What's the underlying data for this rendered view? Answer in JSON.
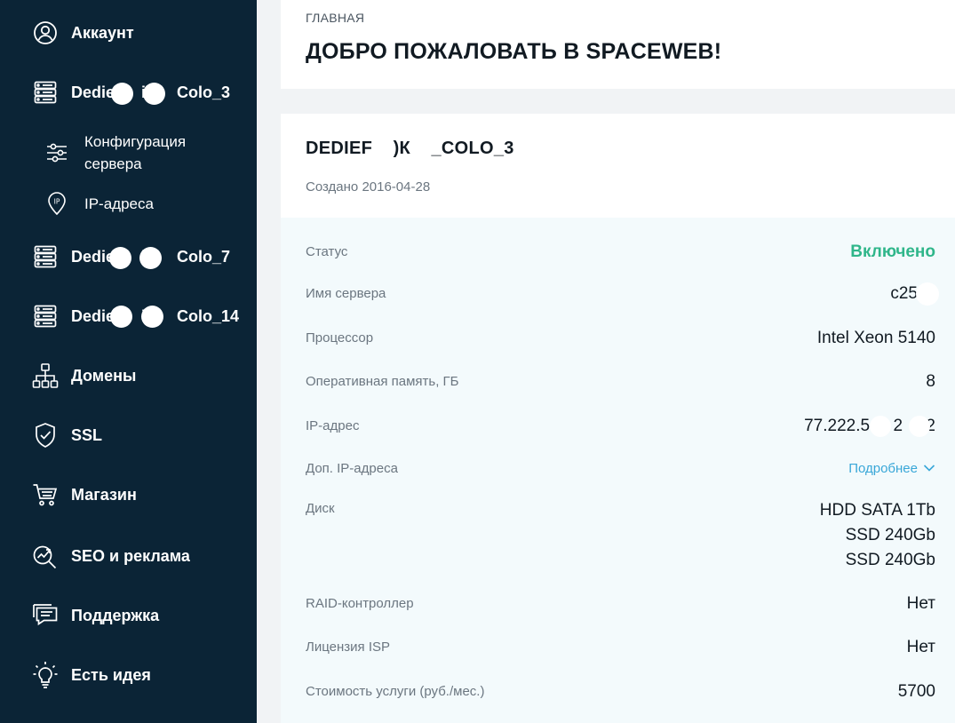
{
  "sidebar": {
    "items": [
      {
        "label": "Аккаунт",
        "icon": "user-circle-icon"
      },
      {
        "label": "Dedie      il      Colo_3",
        "icon": "server-icon"
      },
      {
        "label": "Конфигурация сервера",
        "icon": "sliders-icon"
      },
      {
        "label": "IP-адреса",
        "icon": "ip-pin-icon"
      },
      {
        "label": "Dedie      il      Colo_7",
        "icon": "server-icon"
      },
      {
        "label": "Dedie      il      Colo_14",
        "icon": "server-icon"
      },
      {
        "label": "Домены",
        "icon": "domains-tree-icon"
      },
      {
        "label": "SSL",
        "icon": "shield-check-icon"
      },
      {
        "label": "Магазин",
        "icon": "cart-icon"
      },
      {
        "label": "SEO и реклама",
        "icon": "seo-chart-icon"
      },
      {
        "label": "Поддержка",
        "icon": "support-chat-icon"
      },
      {
        "label": "Есть идея",
        "icon": "lightbulb-icon"
      }
    ]
  },
  "header": {
    "breadcrumb": "ГЛАВНАЯ",
    "title": "ДОБРО ПОЖАЛОВАТЬ В SPACEWEB!"
  },
  "server": {
    "name": "DEDIEF    )К    _COLO_3",
    "created": "Создано 2016-04-28",
    "specs": {
      "status_label": "Статус",
      "status_value": "Включено",
      "hostname_label": "Имя сервера",
      "hostname_value": "c25",
      "cpu_label": "Процессор",
      "cpu_value": "Intel Xeon 5140",
      "ram_label": "Оперативная память, ГБ",
      "ram_value": "8",
      "ip_label": "IP-адрес",
      "ip_value": "77.222.5     2     2",
      "extra_ip_label": "Доп. IP-адреса",
      "extra_ip_link": "Подробнее",
      "disk_label": "Диск",
      "disks": [
        "HDD SATA 1Tb",
        "SSD 240Gb",
        "SSD 240Gb"
      ],
      "raid_label": "RAID-контроллер",
      "raid_value": "Нет",
      "isp_label": "Лицензия ISP",
      "isp_value": "Нет",
      "price_label": "Стоимость услуги (руб./мес.)",
      "price_value": "5700"
    }
  },
  "colors": {
    "sidebar_bg": "#0b2436",
    "status_on": "#2fb68a",
    "link": "#39a7d8"
  }
}
